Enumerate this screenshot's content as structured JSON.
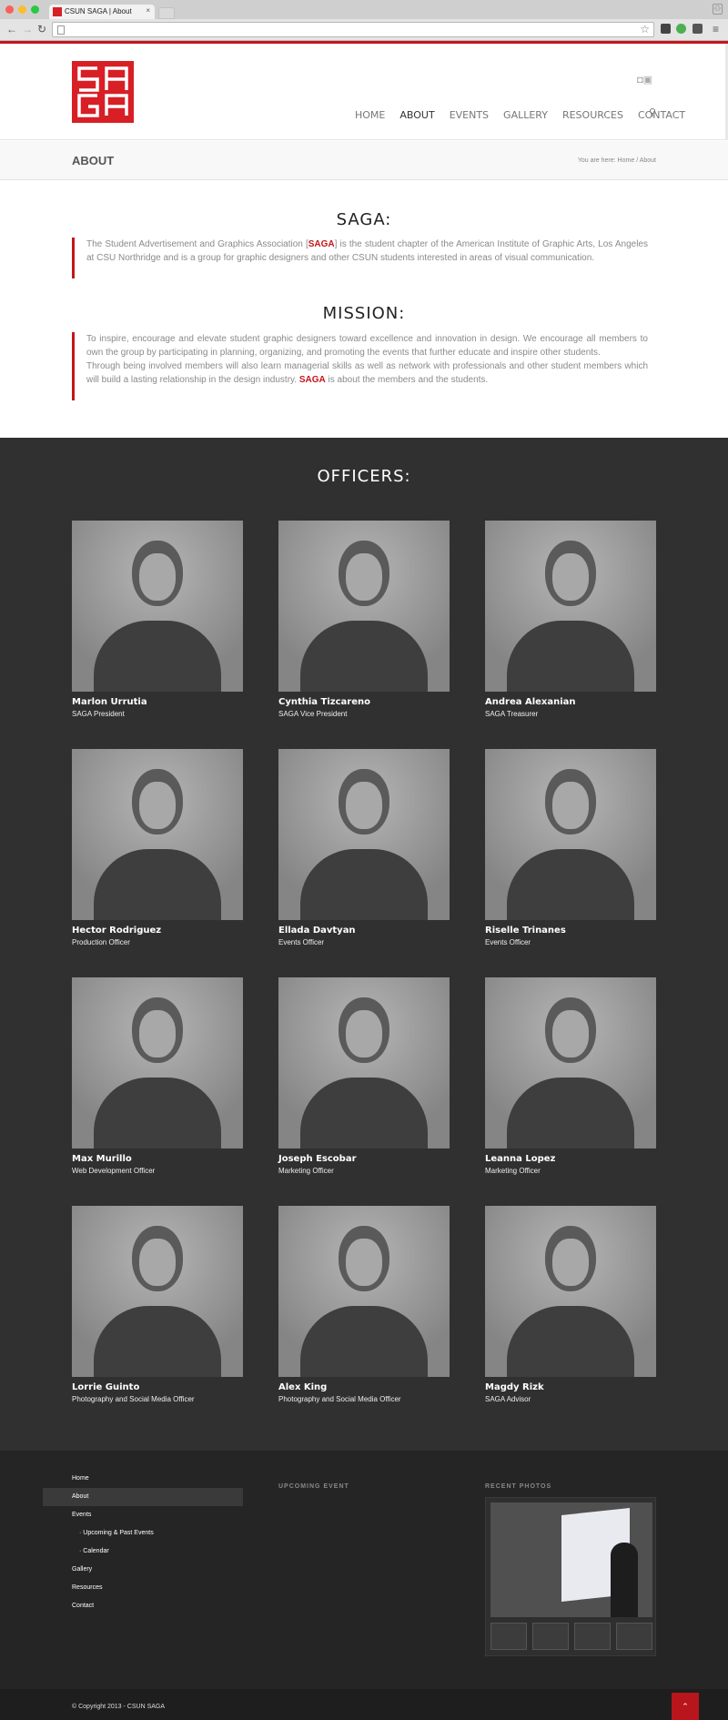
{
  "browser": {
    "tab_title": "CSUN SAGA | About",
    "tab_close": "×",
    "url": "",
    "back": "←",
    "forward": "→",
    "reload": "↻",
    "menu": "≡"
  },
  "header": {
    "logo_text": "SAGA",
    "nav": [
      "HOME",
      "ABOUT",
      "EVENTS",
      "GALLERY",
      "RESOURCES",
      "CONTACT"
    ],
    "active_nav": "ABOUT",
    "social": "◘▣"
  },
  "title_bar": {
    "title": "ABOUT",
    "breadcrumb_prefix": "You are here:",
    "breadcrumb_home": "Home",
    "breadcrumb_sep": "/",
    "breadcrumb_current": "About"
  },
  "saga": {
    "heading": "SAGA:",
    "text_before": "The Student Advertisement and Graphics Association [",
    "highlight": "SAGA",
    "text_after": "] is the student chapter of the American Institute of Graphic Arts, Los Angeles at CSU Northridge and is a group for graphic designers and other CSUN students interested in areas of visual communication."
  },
  "mission": {
    "heading": "MISSION:",
    "para1": "To inspire, encourage and elevate student graphic designers toward excellence and innovation in design. We encourage all members to own the group by participating in planning, organizing, and promoting the events that further educate and inspire other students.",
    "para2_before": "Through being involved members will also learn managerial skills as well as network with professionals and other student members which will build a lasting relationship in the design industry. ",
    "highlight": "SAGA",
    "para2_after": " is about the members and the students."
  },
  "officers": {
    "heading": "OFFICERS:",
    "people": [
      {
        "name": "Marlon Urrutia",
        "role": "SAGA President"
      },
      {
        "name": "Cynthia Tizcareno",
        "role": "SAGA Vice President"
      },
      {
        "name": "Andrea Alexanian",
        "role": "SAGA Treasurer"
      },
      {
        "name": "Hector Rodriguez",
        "role": "Production Officer"
      },
      {
        "name": "Ellada Davtyan",
        "role": "Events Officer"
      },
      {
        "name": "Riselle Trinanes",
        "role": "Events Officer"
      },
      {
        "name": "Max Murillo",
        "role": "Web Development Officer"
      },
      {
        "name": "Joseph Escobar",
        "role": "Marketing Officer"
      },
      {
        "name": "Leanna Lopez",
        "role": "Marketing Officer"
      },
      {
        "name": "Lorrie Guinto",
        "role": "Photography and Social Media Officer"
      },
      {
        "name": "Alex King",
        "role": "Photography and Social Media Officer"
      },
      {
        "name": "Magdy Rizk",
        "role": "SAGA Advisor"
      }
    ]
  },
  "footer": {
    "links": [
      "Home",
      "About",
      "Events",
      "Upcoming & Past Events",
      "Calendar",
      "Gallery",
      "Resources",
      "Contact"
    ],
    "upcoming_heading": "UPCOMING EVENT",
    "recent_heading": "RECENT PHOTOS",
    "copyright": "© Copyright 2013 - CSUN SAGA",
    "to_top": "⌃"
  },
  "colors": {
    "accent": "#c4161c",
    "officers_bg": "#303030",
    "footer_bg": "#252525"
  }
}
